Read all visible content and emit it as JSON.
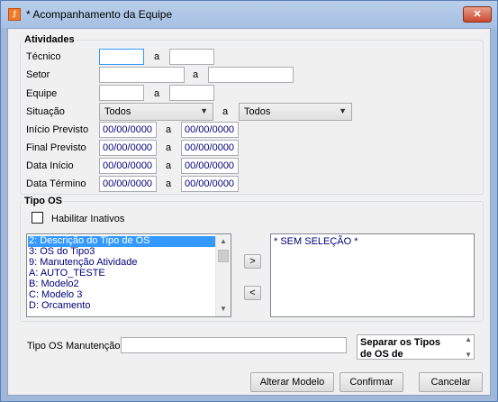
{
  "window": {
    "title": "* Acompanhamento da Equipe",
    "close": "✕"
  },
  "atividades": {
    "legend": "Atividades",
    "sep": "a",
    "tecnico": {
      "label": "Técnico",
      "from": "",
      "to": ""
    },
    "setor": {
      "label": "Setor",
      "from": "",
      "to": ""
    },
    "equipe": {
      "label": "Equipe",
      "from": "",
      "to": ""
    },
    "situacao": {
      "label": "Situação",
      "from": "Todos",
      "to": "Todos"
    },
    "inicio_previsto": {
      "label": "Início Previsto",
      "from": "00/00/0000",
      "to": "00/00/0000"
    },
    "final_previsto": {
      "label": "Final Previsto",
      "from": "00/00/0000",
      "to": "00/00/0000"
    },
    "data_inicio": {
      "label": "Data Início",
      "from": "00/00/0000",
      "to": "00/00/0000"
    },
    "data_termino": {
      "label": "Data Término",
      "from": "00/00/0000",
      "to": "00/00/0000"
    }
  },
  "tipo_os": {
    "legend": "Tipo OS",
    "habilitar_inativos": "Habilitar Inativos",
    "available": [
      "2: Descrição do Tipo de OS",
      "3: OS do Tipo3",
      "9: Manutenção Atividade",
      "A: AUTO_TESTE",
      "B: Modelo2",
      "C: Modelo 3",
      "D: Orcamento"
    ],
    "selected_index": 0,
    "selected_list_text": "* SEM SELEÇÃO *",
    "add_button": ">",
    "remove_button": "<"
  },
  "manutencao": {
    "label": "Tipo OS Manutenção",
    "value": "",
    "memo_text": "Separar os Tipos de OS de manutenção"
  },
  "footer": {
    "alterar_modelo": "Alterar Modelo",
    "confirmar": "Confirmar",
    "cancelar": "Cancelar"
  },
  "icons": {
    "app": "app-icon",
    "close": "close-icon",
    "dropdown": "chevron-down-icon",
    "scroll_up": "chevron-up-icon",
    "scroll_down": "chevron-down-icon"
  }
}
